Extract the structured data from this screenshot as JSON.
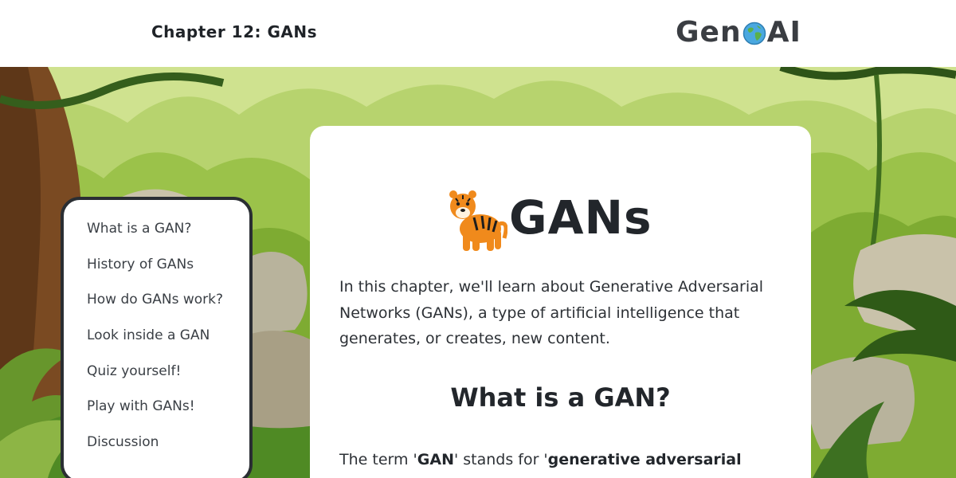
{
  "header": {
    "chapter_title": "Chapter 12: GANs",
    "logo_text_left": "Gen",
    "logo_text_right": "AI",
    "logo_icon": "globe-icon"
  },
  "sidebar": {
    "items": [
      {
        "label": "What is a GAN?"
      },
      {
        "label": "History of GANs"
      },
      {
        "label": "How do GANs work?"
      },
      {
        "label": "Look inside a GAN"
      },
      {
        "label": "Quiz yourself!"
      },
      {
        "label": "Play with GANs!"
      },
      {
        "label": "Discussion"
      }
    ]
  },
  "main": {
    "title_icon": "tiger-icon",
    "title": "GANs",
    "intro": "In this chapter, we'll learn about Generative Adversarial Networks (GANs), a type of artificial intelligence that generates, or creates, new content.",
    "section_heading": "What is a GAN?",
    "body_prefix": "The term '",
    "body_term": "GAN",
    "body_middle": "' stands for '",
    "body_expansion": "generative adversarial"
  },
  "colors": {
    "jungle_light": "#c9de8a",
    "jungle_mid": "#8fb83a",
    "jungle_dark": "#3f6e1f",
    "trunk": "#7a4a22",
    "rock": "#b8b39c",
    "sidebar_border": "#2a2e33"
  }
}
